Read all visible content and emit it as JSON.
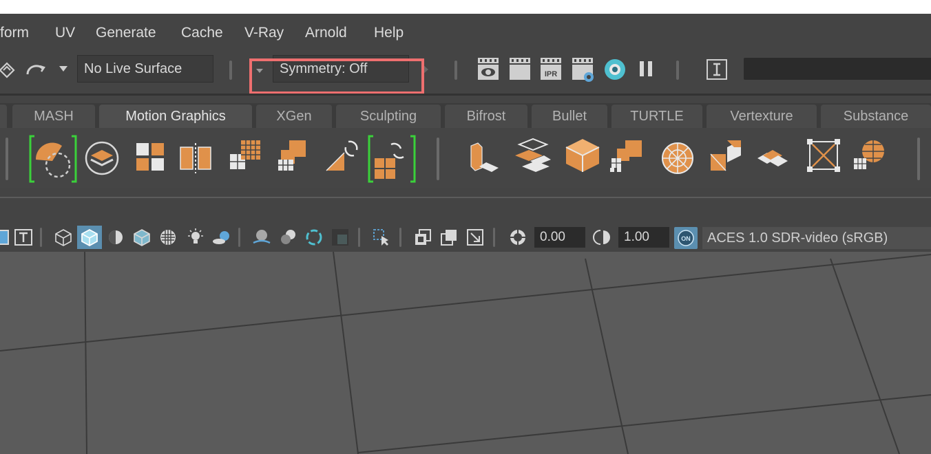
{
  "menu": {
    "items": [
      {
        "label": "form"
      },
      {
        "label": "UV"
      },
      {
        "label": "Generate"
      },
      {
        "label": "Cache"
      },
      {
        "label": "V-Ray"
      },
      {
        "label": "Arnold"
      },
      {
        "label": "Help"
      }
    ]
  },
  "statusline": {
    "live_surface": "No Live Surface",
    "symmetry": "Symmetry: Off"
  },
  "shelf": {
    "tabs": [
      {
        "label": "MASH",
        "active": false
      },
      {
        "label": "Motion Graphics",
        "active": true
      },
      {
        "label": "XGen",
        "active": false
      },
      {
        "label": "Sculpting",
        "active": false
      },
      {
        "label": "Bifrost",
        "active": false
      },
      {
        "label": "Bullet",
        "active": false
      },
      {
        "label": "TURTLE",
        "active": false
      },
      {
        "label": "Vertexture",
        "active": false
      },
      {
        "label": "Substance",
        "active": false
      }
    ],
    "accent_color": "#e0914a",
    "selection_bracket_color": "#3ad13a"
  },
  "panel_toolbar": {
    "exposure": "0.00",
    "gamma": "1.00",
    "color_management": "ACES 1.0 SDR-video (sRGB)",
    "on_badge": "ON"
  },
  "colors": {
    "highlight": "#ee6f6f",
    "background": "#444444",
    "viewport": "#5b5b5b"
  }
}
